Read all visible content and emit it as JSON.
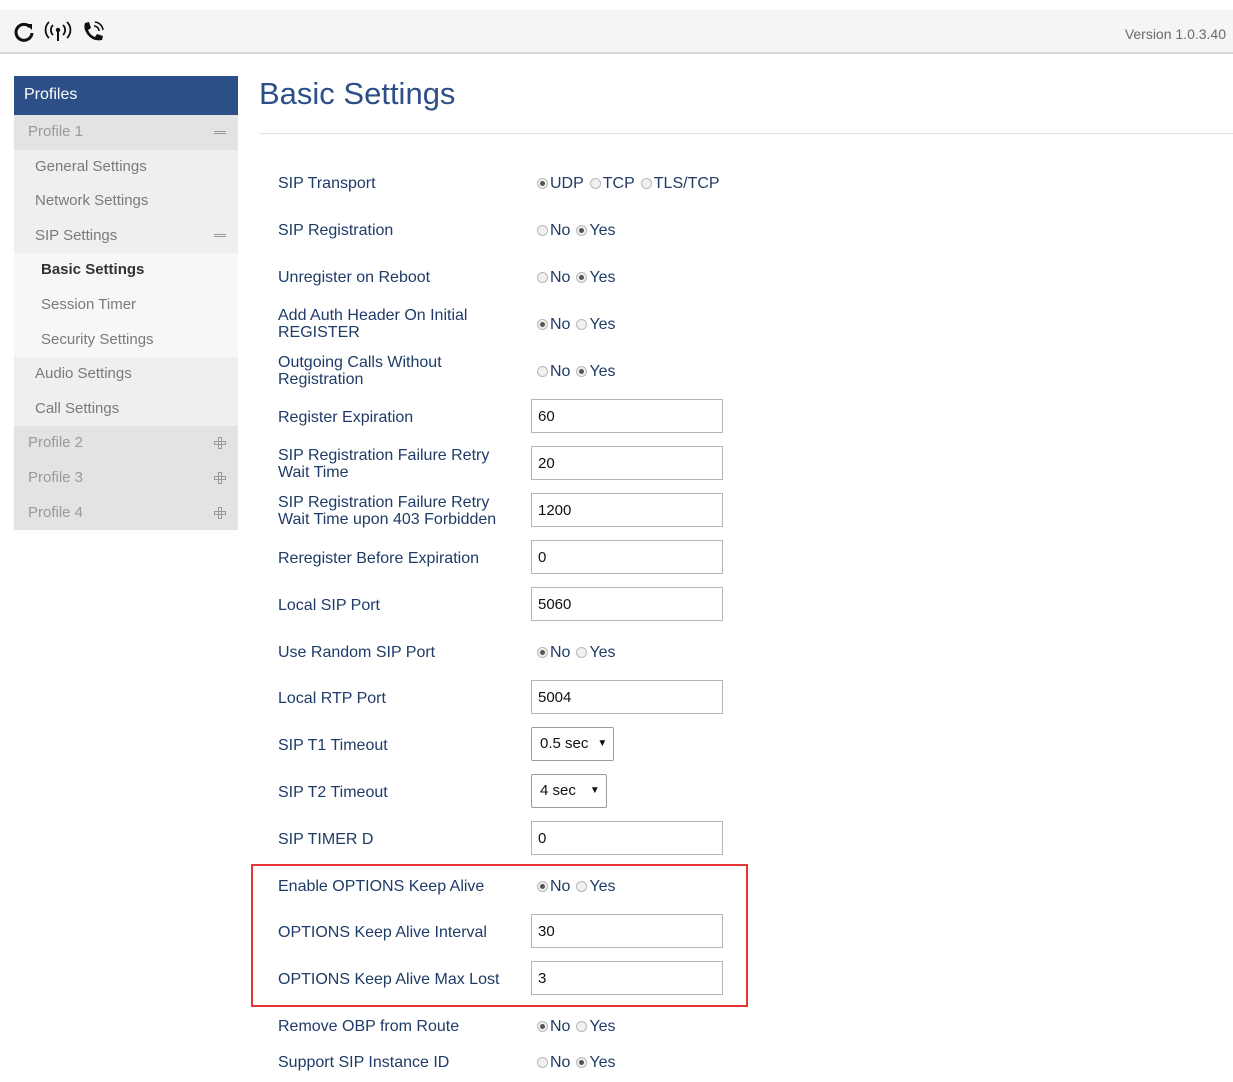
{
  "topbar": {
    "icons": [
      "refresh-icon",
      "wireless-signal-icon",
      "phone-call-icon"
    ],
    "version": "Version 1.0.3.40"
  },
  "sidebar": {
    "header": "Profiles",
    "profile1": "Profile 1",
    "items": {
      "general": "General Settings",
      "network": "Network Settings",
      "sip": "SIP Settings",
      "basic": "Basic Settings",
      "session": "Session Timer",
      "security": "Security Settings",
      "audio": "Audio Settings",
      "call": "Call Settings"
    },
    "profile2": "Profile 2",
    "profile3": "Profile 3",
    "profile4": "Profile 4"
  },
  "page": {
    "title": "Basic Settings"
  },
  "opts": {
    "no": "No",
    "yes": "Yes",
    "udp": "UDP",
    "tcp": "TCP",
    "tls": "TLS/TCP"
  },
  "fields": {
    "sip_transport": {
      "label": "SIP Transport",
      "selected": "UDP"
    },
    "sip_registration": {
      "label": "SIP Registration",
      "selected": "Yes"
    },
    "unregister_reboot": {
      "label": "Unregister on Reboot",
      "selected": "Yes"
    },
    "add_auth_header": {
      "label": "Add Auth Header On Initial REGISTER",
      "selected": "No"
    },
    "outgoing_without_reg": {
      "label": "Outgoing Calls Without Registration",
      "selected": "Yes"
    },
    "register_expiration": {
      "label": "Register Expiration",
      "value": "60"
    },
    "reg_failure_retry": {
      "label": "SIP Registration Failure Retry Wait Time",
      "value": "20"
    },
    "reg_failure_retry_403": {
      "label": "SIP Registration Failure Retry Wait Time upon 403 Forbidden",
      "value": "1200"
    },
    "reregister_before": {
      "label": "Reregister Before Expiration",
      "value": "0"
    },
    "local_sip_port": {
      "label": "Local SIP Port",
      "value": "5060"
    },
    "random_sip_port": {
      "label": "Use Random SIP Port",
      "selected": "No"
    },
    "local_rtp_port": {
      "label": "Local RTP Port",
      "value": "5004"
    },
    "sip_t1": {
      "label": "SIP T1 Timeout",
      "value": "0.5 sec"
    },
    "sip_t2": {
      "label": "SIP T2 Timeout",
      "value": "4 sec"
    },
    "sip_timer_d": {
      "label": "SIP TIMER D",
      "value": "0"
    },
    "options_keepalive": {
      "label": "Enable OPTIONS Keep Alive",
      "selected": "No"
    },
    "options_interval": {
      "label": "OPTIONS Keep Alive Interval",
      "value": "30"
    },
    "options_max_lost": {
      "label": "OPTIONS Keep Alive Max Lost",
      "value": "3"
    },
    "remove_obp": {
      "label": "Remove OBP from Route",
      "selected": "No"
    },
    "sip_instance_id": {
      "label": "Support SIP Instance ID",
      "selected": "Yes"
    }
  },
  "colors": {
    "sidebar_header": "#2b4f86",
    "title": "#2b4f86",
    "label": "#1f3b67",
    "highlight": "#e53535"
  }
}
